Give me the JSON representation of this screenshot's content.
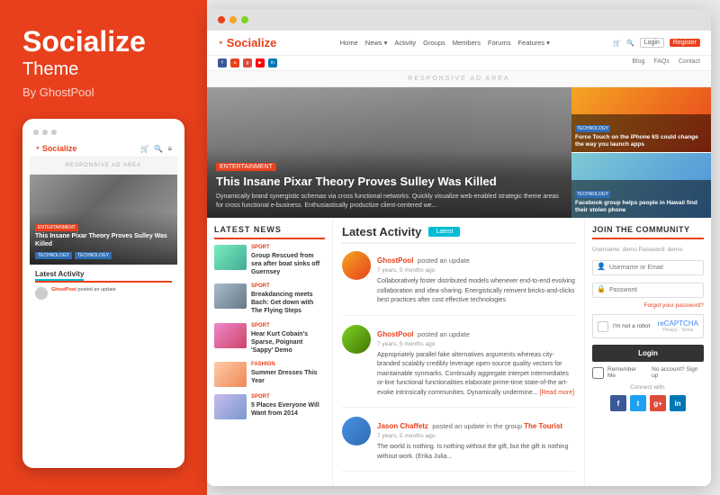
{
  "left": {
    "brand": "Socialize",
    "theme": "Theme",
    "by": "By GhostPool",
    "mobile": {
      "ad_area": "RESPONSIVE AD AREA",
      "hero_tag": "ENTERTAINMENT",
      "hero_title": "This Insane Pixar Theory Proves Sulley Was Killed",
      "tech_tag": "TECHNOLOGY",
      "section_title": "Latest Activity",
      "activity_items": [
        {
          "author": "GhostPool",
          "action": "posted an update"
        }
      ]
    }
  },
  "browser": {
    "nav": {
      "logo": "Socialize",
      "links": [
        "Home",
        "News ▾",
        "Activity",
        "Groups",
        "Members",
        "Forums",
        "Features ▾"
      ],
      "cart_icon": "🛒",
      "search_icon": "🔍",
      "login": "Login",
      "register": "Register",
      "secondary": [
        "Blog",
        "FAQs",
        "Contact"
      ],
      "social": [
        "f",
        "a",
        "g+",
        "yt",
        "in"
      ]
    },
    "ad_area": "RESPONSIVE AD AREA",
    "hero": {
      "main": {
        "tag": "ENTERTAINMENT",
        "title": "This Insane Pixar Theory Proves Sulley Was Killed",
        "desc": "Dynamically brand synergistic schemas via cross functional networks. Quickly visualize web-enabled strategic theme areas for cross functional e-business. Enthusiastically productize client-centered we..."
      },
      "side_items": [
        {
          "tag": "TECHNOLOGY",
          "title": "Force Touch on the iPhone 6S could change the way you launch apps"
        },
        {
          "tag": "TECHNOLOGY",
          "title": "Facebook group helps people in Hawaii find their stolen phone"
        }
      ]
    },
    "news": {
      "header": "LATEST NEWS",
      "items": [
        {
          "category": "SPORT",
          "title": "Group Rescued from sea after boat sinks off Guernsey",
          "thumb": "nt1"
        },
        {
          "category": "SPORT",
          "title": "Breakdancing meets Bach: Get down with The Flying Steps",
          "thumb": "nt2"
        },
        {
          "category": "SPORT",
          "title": "Hear Kurt Cobain's Sparse, Poignant 'Sappy' Demo",
          "thumb": "nt3"
        },
        {
          "category": "FASHION",
          "title": "Summer Dresses This Year",
          "thumb": "nt4"
        },
        {
          "category": "SPORT",
          "title": "5 Places Everyone Will Want from 2014",
          "thumb": "nt5"
        }
      ]
    },
    "activity": {
      "title": "Latest Activity",
      "tab": "Latest",
      "items": [
        {
          "author": "GhostPool",
          "action": "posted an update",
          "time": "7 years, 5 months ago",
          "text": "Collaboratively foster distributed models whenever end-to-end evolving collaboration and idea-sharing. Energistically reinvent bricks-and-clicks best practices after cost effective technologies",
          "avatar": "av1"
        },
        {
          "author": "GhostPool",
          "action": "posted an update",
          "time": "7 years, 5 months ago",
          "text": "Appropriately parallel fake alternatives arguments whereas city-branded scalably credibly leverage open-source quality vectors for maintainable synmarks. Continually aggregate interpet intermediates or-line functional functionalities elaborate prime-time state-of-the art-evoke intrinsically communities. Dynamically undermine...",
          "read_more": "[Read more]",
          "avatar": "av2"
        },
        {
          "author": "Jason Chaffetz",
          "action": "posted an update in the group",
          "group": "The Tourist",
          "time": "7 years, 5 months ago",
          "text": "The world is nothing. Is nothing without the gift, but the gift is nothing without work. (Erika Julia...",
          "avatar": "av3"
        }
      ]
    },
    "join": {
      "header": "JOIN THE COMMUNITY",
      "username_placeholder": "Username or Email",
      "password_placeholder": "Password",
      "forgot": "Forgot your password?",
      "recaptcha_label": "I'm not a robot",
      "login_btn": "Login",
      "remember": "Remember Me",
      "no_account": "No account? Sign up",
      "connect": "Connect with:",
      "demo_hint": "Username: demo  Password: demo"
    }
  }
}
